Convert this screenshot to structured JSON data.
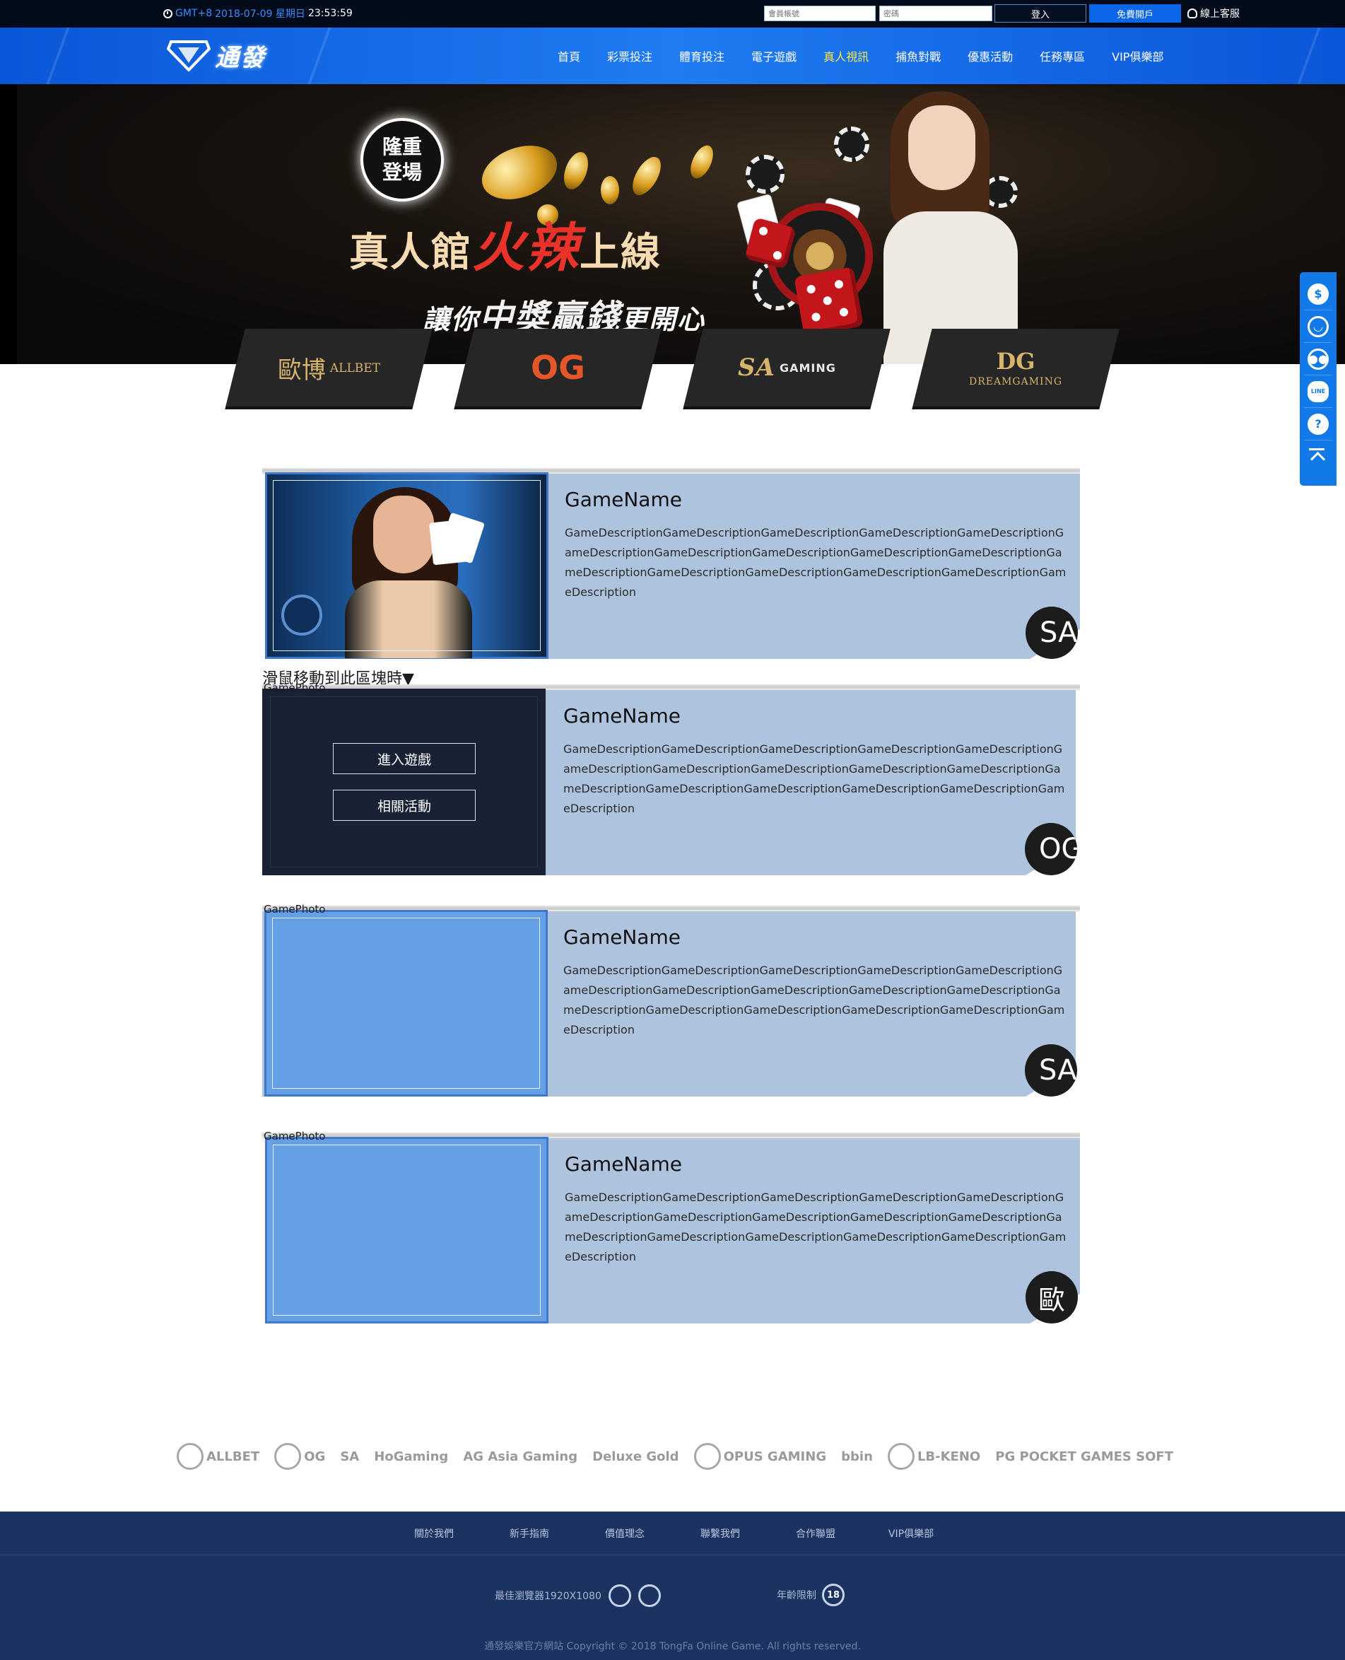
{
  "topbar": {
    "timezone": "GMT+8",
    "date": "2018-07-09 星期日",
    "time": "23:53:59",
    "account_placeholder": "會員帳號",
    "password_placeholder": "密碼",
    "login_label": "登入",
    "register_label": "免費開戶",
    "support_label": "線上客服"
  },
  "nav": {
    "brand": "通發",
    "items": [
      {
        "label": "首頁",
        "active": false
      },
      {
        "label": "彩票投注",
        "active": false
      },
      {
        "label": "體育投注",
        "active": false
      },
      {
        "label": "電子遊戲",
        "active": false
      },
      {
        "label": "真人視訊",
        "active": true
      },
      {
        "label": "捕魚對戰",
        "active": false
      },
      {
        "label": "優惠活動",
        "active": false
      },
      {
        "label": "任務專區",
        "active": false
      },
      {
        "label": "VIP俱樂部",
        "active": false
      }
    ]
  },
  "banner": {
    "badge_line1": "隆重",
    "badge_line2": "登場",
    "headline_a": "真人館",
    "headline_b": "火辣",
    "headline_c": "上線",
    "sub_a": "讓你",
    "sub_b": "中獎贏錢",
    "sub_c": "更開心"
  },
  "provider_tabs": [
    {
      "name": "ALLBET",
      "mark": "歐博"
    },
    {
      "name": "",
      "mark": "OG"
    },
    {
      "name": "GAMING",
      "mark": "SA"
    },
    {
      "name": "DREAMGAMING",
      "mark": "DG"
    }
  ],
  "floatbar": {
    "icons": [
      "dollar-icon",
      "headset-icon",
      "wechat-icon",
      "line-icon",
      "help-icon",
      "back-to-top-icon"
    ],
    "dollar": "$",
    "line": "LINE",
    "help": "?"
  },
  "hover_hint": "滑鼠移動到此區塊時▼",
  "games": [
    {
      "photo_label": "",
      "name": "GameName",
      "description": "GameDescriptionGameDescriptionGameDescriptionGameDescriptionGameDescriptionGameDescriptionGameDescriptionGameDescriptionGameDescriptionGameDescriptionGameDescriptionGameDescriptionGameDescriptionGameDescriptionGameDescriptionGameDescription",
      "provider_badge": "SA"
    },
    {
      "photo_label": "GamePhoto",
      "name": "GameName",
      "description": "GameDescriptionGameDescriptionGameDescriptionGameDescriptionGameDescriptionGameDescriptionGameDescriptionGameDescriptionGameDescriptionGameDescriptionGameDescriptionGameDescriptionGameDescriptionGameDescriptionGameDescriptionGameDescription",
      "provider_badge": "OG",
      "enter_label": "進入遊戲",
      "promo_label": "相關活動"
    },
    {
      "photo_label": "GamePhoto",
      "name": "GameName",
      "description": "GameDescriptionGameDescriptionGameDescriptionGameDescriptionGameDescriptionGameDescriptionGameDescriptionGameDescriptionGameDescriptionGameDescriptionGameDescriptionGameDescriptionGameDescriptionGameDescriptionGameDescriptionGameDescription",
      "provider_badge": "SA"
    },
    {
      "photo_label": "GamePhoto",
      "name": "GameName",
      "description": "GameDescriptionGameDescriptionGameDescriptionGameDescriptionGameDescriptionGameDescriptionGameDescriptionGameDescriptionGameDescriptionGameDescriptionGameDescriptionGameDescriptionGameDescriptionGameDescriptionGameDescriptionGameDescription",
      "provider_badge": "歐"
    }
  ],
  "partners": [
    "ALLBET",
    "OG",
    "SA",
    "HoGaming",
    "AG Asia Gaming",
    "Deluxe Gold",
    "OPUS GAMING",
    "bbin",
    "LB-KENO",
    "PG POCKET GAMES SOFT"
  ],
  "footer": {
    "links": [
      "關於我們",
      "新手指南",
      "價值理念",
      "聯繫我們",
      "合作聯盟",
      "VIP俱樂部"
    ],
    "browser_note": "最佳瀏覽器1920X1080",
    "age_note": "年齡限制",
    "age_badge": "18",
    "copyright": "通發娛樂官方網站 Copyright © 2018 TongFa Online Game. All rights reserved."
  }
}
